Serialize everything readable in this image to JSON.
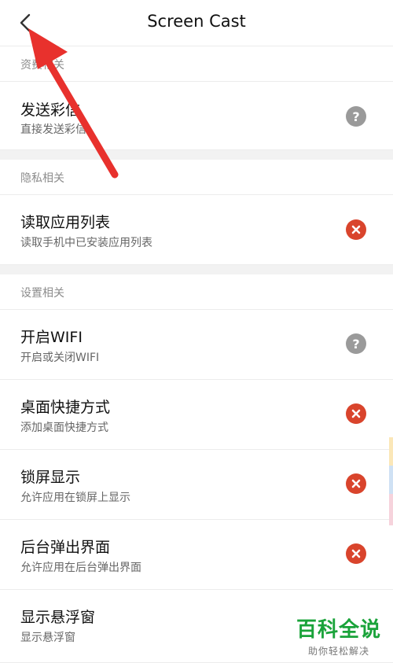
{
  "header": {
    "title": "Screen Cast",
    "back_icon": "chevron-left-icon"
  },
  "sections": [
    {
      "header": "资费相关",
      "items": [
        {
          "title": "发送彩信",
          "subtitle": "直接发送彩信",
          "status": "question"
        }
      ]
    },
    {
      "header": "隐私相关",
      "items": [
        {
          "title": "读取应用列表",
          "subtitle": "读取手机中已安装应用列表",
          "status": "denied"
        }
      ]
    },
    {
      "header": "设置相关",
      "items": [
        {
          "title": "开启WIFI",
          "subtitle": "开启或关闭WIFI",
          "status": "question"
        },
        {
          "title": "桌面快捷方式",
          "subtitle": "添加桌面快捷方式",
          "status": "denied"
        },
        {
          "title": "锁屏显示",
          "subtitle": "允许应用在锁屏上显示",
          "status": "denied"
        },
        {
          "title": "后台弹出界面",
          "subtitle": "允许应用在后台弹出界面",
          "status": "denied"
        },
        {
          "title": "显示悬浮窗",
          "subtitle": "显示悬浮窗",
          "status": "none"
        }
      ]
    }
  ],
  "watermark": {
    "main": "百科全说",
    "sub": "助你轻松解决"
  },
  "colors": {
    "denied": "#d9442c",
    "question": "#9a9a9a",
    "annotation_arrow": "#e8312d",
    "watermark": "#1aa33a"
  }
}
